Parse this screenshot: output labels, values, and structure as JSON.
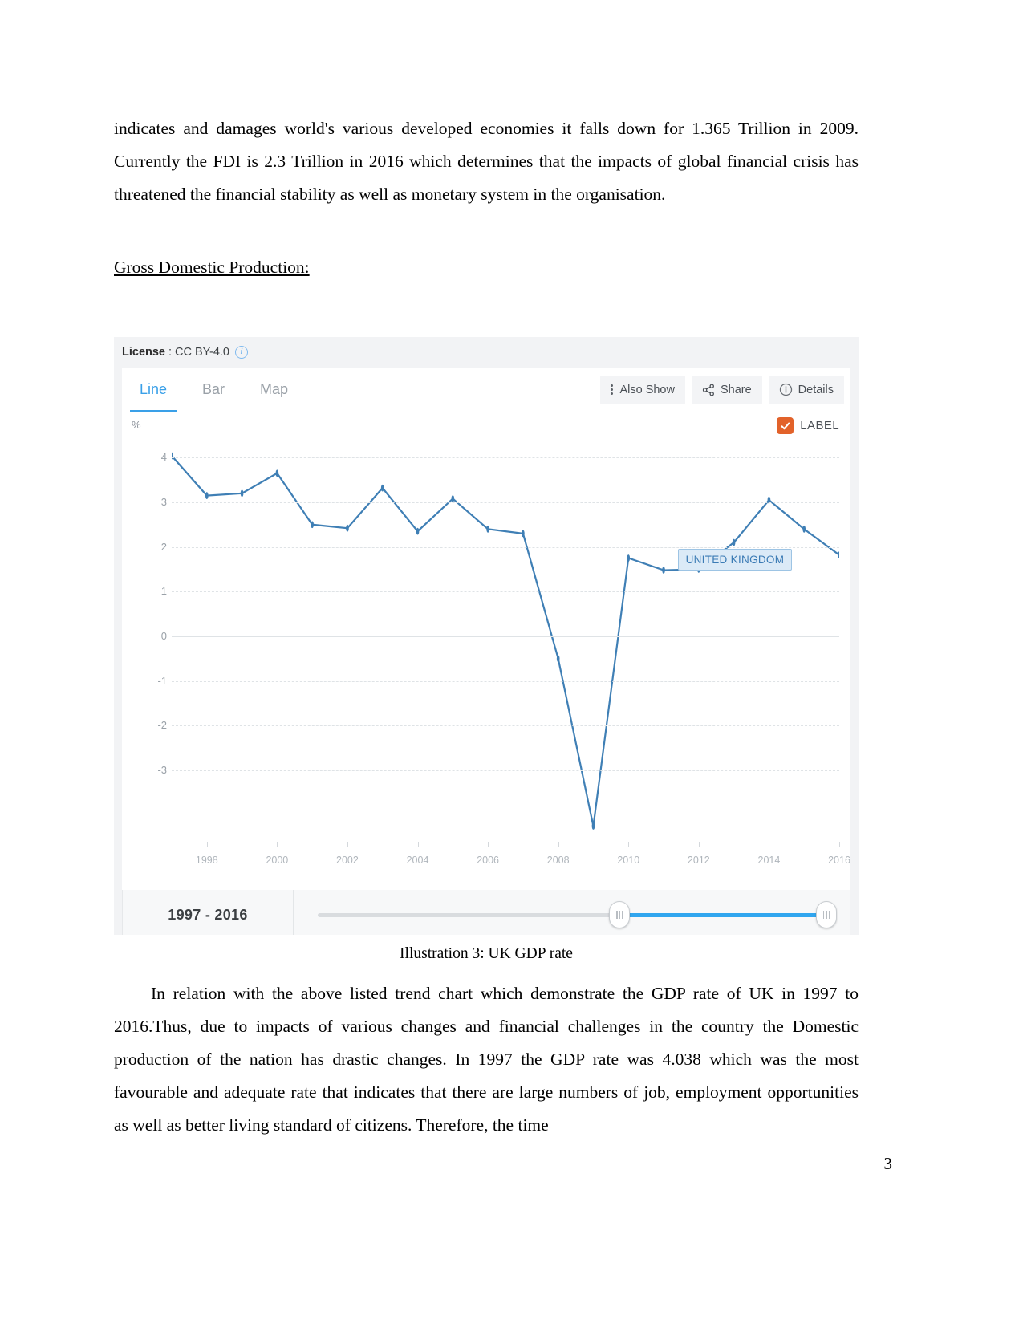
{
  "document": {
    "paragraph_1": "indicates and damages world's various developed economies it falls down for 1.365 Trillion in 2009. Currently the FDI is 2.3 Trillion in 2016 which determines that the impacts of global financial crisis has threatened the financial stability as well as monetary system in the organisation.",
    "heading_gdp": "Gross Domestic Production:",
    "caption": "Illustration 3: UK  GDP rate",
    "paragraph_2": "In relation with the above listed trend chart which demonstrate the GDP rate of UK in 1997 to 2016.Thus, due to impacts of various changes and financial challenges in the country the Domestic production of the nation has drastic changes. In 1997 the GDP rate was 4.038 which was the most favourable and adequate rate that indicates that there are large numbers of job, employment opportunities as well as better living standard of citizens. Therefore, the time",
    "page_number": "3"
  },
  "widget": {
    "license": {
      "key": "License",
      "separator": ":",
      "value": "CC BY-4.0",
      "info_icon": "info-circle-icon"
    },
    "tabs": [
      {
        "label": "Line",
        "active": true
      },
      {
        "label": "Bar",
        "active": false
      },
      {
        "label": "Map",
        "active": false
      }
    ],
    "buttons": [
      {
        "label": "Also Show",
        "icon": "kebab-menu-icon"
      },
      {
        "label": "Share",
        "icon": "share-icon"
      },
      {
        "label": "Details",
        "icon": "info-circle-icon"
      }
    ],
    "label_toggle": {
      "label": "LABEL",
      "checked": true,
      "color": "#e2622a"
    },
    "country_badge": "UNITED KINGDOM",
    "range": {
      "label": "1997 - 2016",
      "accent": "#31a6ef"
    }
  },
  "chart_data": {
    "type": "line",
    "title": "",
    "xlabel": "",
    "ylabel": "%",
    "axis_unit": "%",
    "series_name": "UNITED KINGDOM",
    "line_color": "#3f7fb5",
    "ylim": [
      -4.6,
      4.4
    ],
    "yticks": [
      4,
      3,
      2,
      1,
      0,
      -1,
      -2,
      -3
    ],
    "ytick_labels": [
      "4",
      "3",
      "2",
      "1",
      "0",
      "-1",
      "-2",
      "-3"
    ],
    "xlim": [
      1997,
      2016
    ],
    "xticks": [
      1998,
      2000,
      2002,
      2004,
      2006,
      2008,
      2010,
      2012,
      2014,
      2016
    ],
    "xtick_labels": [
      "1998",
      "2000",
      "2002",
      "2004",
      "2006",
      "2008",
      "2010",
      "2012",
      "2014",
      "2016"
    ],
    "grid": true,
    "legend": "none",
    "x": [
      1997,
      1998,
      1999,
      2000,
      2001,
      2002,
      2003,
      2004,
      2005,
      2006,
      2007,
      2008,
      2009,
      2010,
      2011,
      2012,
      2013,
      2014,
      2015,
      2016
    ],
    "values": [
      4.04,
      3.15,
      3.2,
      3.65,
      2.5,
      2.42,
      3.32,
      2.35,
      3.08,
      2.4,
      2.3,
      -0.5,
      -4.25,
      1.75,
      1.48,
      1.5,
      2.1,
      3.05,
      2.4,
      1.82
    ]
  }
}
